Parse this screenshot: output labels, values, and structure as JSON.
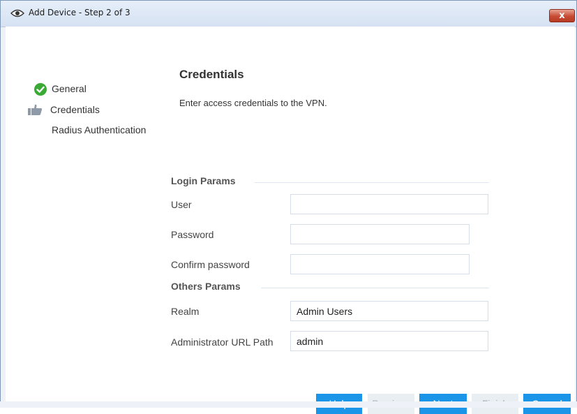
{
  "window": {
    "title": "Add Device - Step 2 of 3",
    "close_glyph": "x",
    "icon": "eye-icon"
  },
  "sidebar": {
    "steps": [
      {
        "label": "General",
        "state": "complete",
        "icon": "check-circle-icon"
      },
      {
        "label": "Credentials",
        "state": "current",
        "icon": "thumbs-up-icon"
      },
      {
        "label": "Radius Authentication",
        "state": "pending",
        "icon": ""
      }
    ]
  },
  "main": {
    "heading": "Credentials",
    "description": "Enter access credentials to the VPN.",
    "login_section": "Login Params",
    "others_section": "Others Params",
    "fields": {
      "user": {
        "label": "User",
        "value": ""
      },
      "password": {
        "label": "Password",
        "value": ""
      },
      "confirm_password": {
        "label": "Confirm password",
        "value": ""
      },
      "realm": {
        "label": "Realm",
        "value": "Admin Users"
      },
      "admin_url": {
        "label": "Administrator URL Path",
        "value": "admin"
      }
    }
  },
  "buttons": {
    "help": "Help",
    "previous": "Previous",
    "next": "Next",
    "finish": "Finish",
    "cancel": "Cancel"
  },
  "colors": {
    "accent": "#1a95e8",
    "success": "#3aa935",
    "disabled": "#e9eef3"
  }
}
